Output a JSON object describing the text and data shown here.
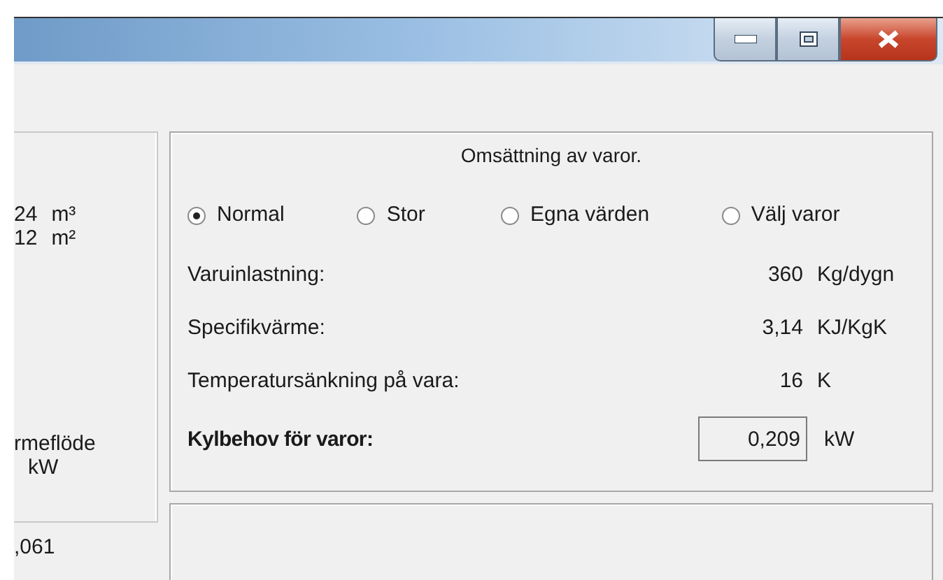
{
  "left_panel": {
    "quantities": [
      {
        "value": "24",
        "unit": "m³"
      },
      {
        "value": "12",
        "unit": "m²"
      }
    ],
    "flow_label": "rmeflöde",
    "flow_unit": "kW",
    "bottom_value": ",061"
  },
  "goods_panel": {
    "title": "Omsättning av varor.",
    "options": [
      {
        "label": "Normal",
        "selected": true
      },
      {
        "label": "Stor",
        "selected": false
      },
      {
        "label": "Egna värden",
        "selected": false
      },
      {
        "label": "Välj varor",
        "selected": false
      }
    ],
    "rows": [
      {
        "label": "Varuinlastning:",
        "value": "360",
        "unit": "Kg/dygn"
      },
      {
        "label": "Specifikvärme:",
        "value": "3,14",
        "unit": "KJ/KgK"
      },
      {
        "label": "Temperatursänkning på vara:",
        "value": "16",
        "unit": "K"
      }
    ],
    "result": {
      "label": "Kylbehov för varor:",
      "value": "0,209",
      "unit": "kW"
    }
  }
}
